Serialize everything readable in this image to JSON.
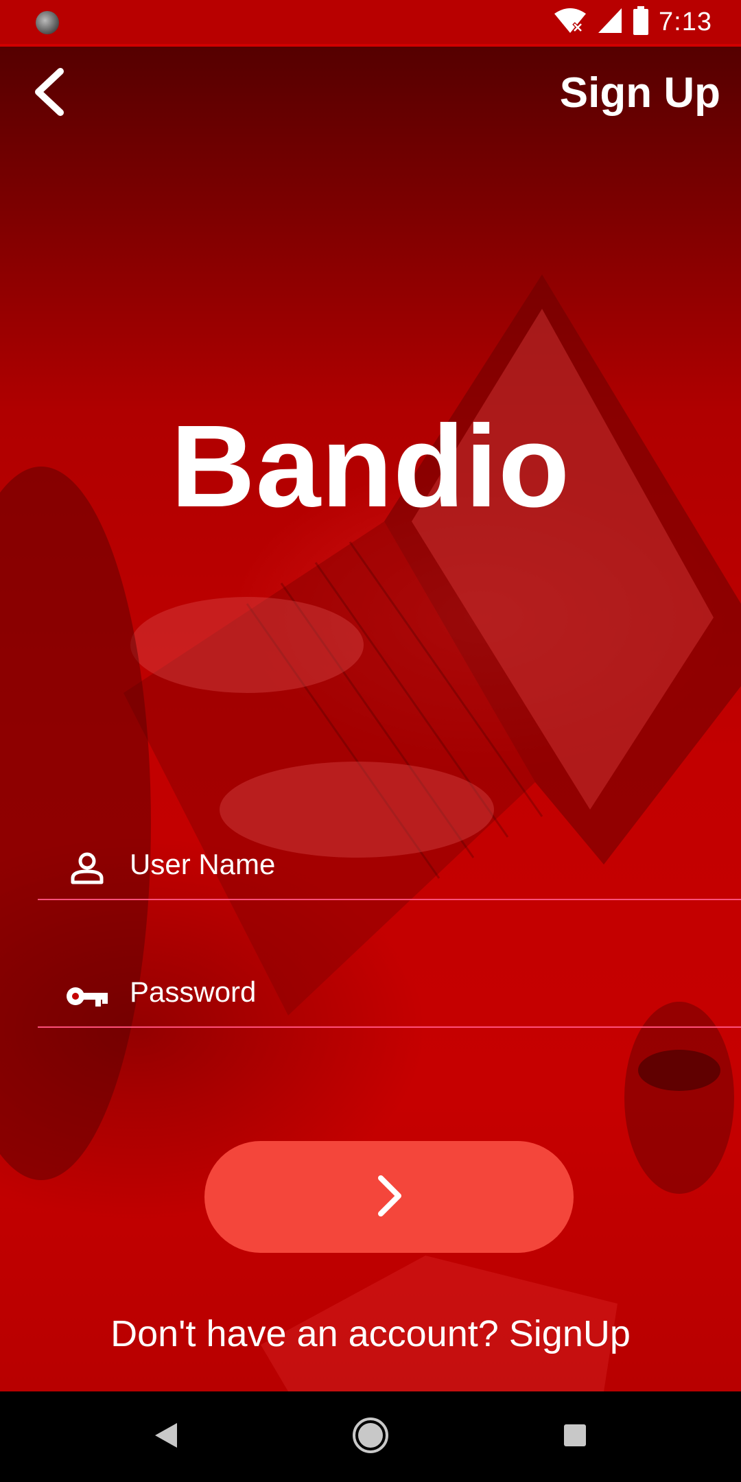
{
  "status_bar": {
    "time": "7:13",
    "icons": [
      "wifi-no-internet-icon",
      "cell-signal-icon",
      "battery-icon"
    ]
  },
  "header": {
    "back_icon": "chevron-left-icon",
    "signup_label": "Sign Up"
  },
  "app": {
    "title": "Bandio"
  },
  "form": {
    "username": {
      "placeholder": "User Name",
      "value": "",
      "icon": "person-icon"
    },
    "password": {
      "placeholder": "Password",
      "value": "",
      "icon": "key-icon"
    },
    "submit_icon": "chevron-right-icon"
  },
  "footer": {
    "signup_prompt": "Don't have an account? SignUp"
  },
  "nav_bar": {
    "icons": [
      "nav-back-icon",
      "nav-home-icon",
      "nav-recents-icon"
    ]
  },
  "colors": {
    "background_tint": "#c40000",
    "button": "#f4463b",
    "field_underline": "#ff4f7a",
    "text": "#ffffff",
    "nav_bar": "#000000"
  }
}
